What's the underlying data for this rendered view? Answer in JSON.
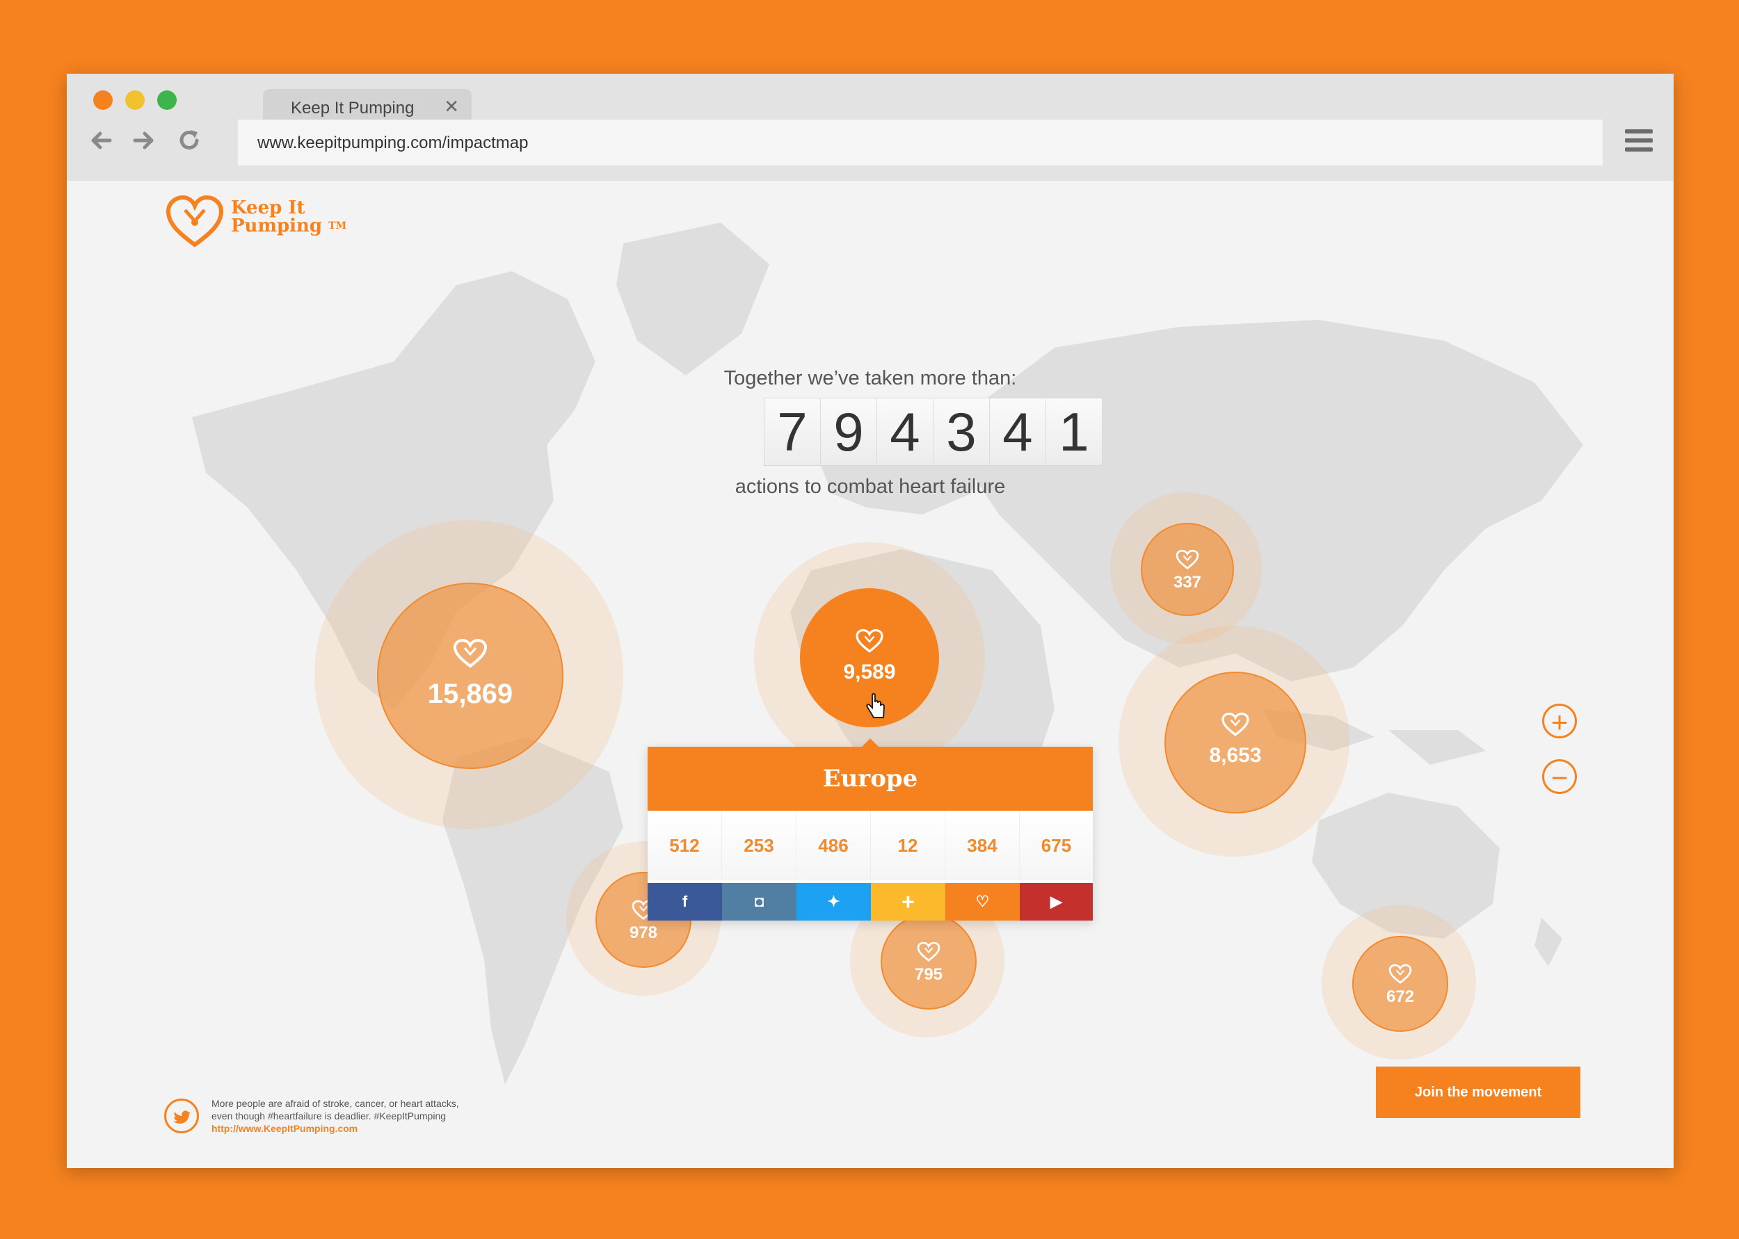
{
  "browser": {
    "tab_title": "Keep It Pumping",
    "tab_close": "✕",
    "url": "www.keepitpumping.com/impactmap"
  },
  "logo": {
    "line1": "Keep It",
    "line2": "Pumping",
    "tm": "TM"
  },
  "counter": {
    "intro": "Together we’ve taken more than:",
    "digits": [
      "7",
      "9",
      "4",
      "3",
      "4",
      "1"
    ],
    "outro": "actions to combat heart failure"
  },
  "bubbles": [
    {
      "value": "15,869"
    },
    {
      "value": "9,589"
    },
    {
      "value": "337"
    },
    {
      "value": "8,653"
    },
    {
      "value": "978"
    },
    {
      "value": "795"
    },
    {
      "value": "672"
    }
  ],
  "popup": {
    "region": "Europe",
    "counts": [
      "512",
      "253",
      "486",
      "12",
      "384",
      "675"
    ],
    "networks": [
      {
        "icon": "facebook-icon",
        "glyph": "f",
        "color": "#3b5998"
      },
      {
        "icon": "instagram-icon",
        "glyph": "◘",
        "color": "#517fa4"
      },
      {
        "icon": "twitter-icon",
        "glyph": "✦",
        "color": "#1da1f2"
      },
      {
        "icon": "plus-icon",
        "glyph": "+",
        "color": "#fdb92c"
      },
      {
        "icon": "heart-icon",
        "glyph": "♡",
        "color": "#f5821f"
      },
      {
        "icon": "youtube-icon",
        "glyph": "▶",
        "color": "#c4302b"
      }
    ]
  },
  "zoom": {
    "in": "+",
    "out": "−"
  },
  "footer": {
    "tweet_line1": "More people are afraid of stroke, cancer, or heart attacks,",
    "tweet_line2": "even though #heartfailure is deadlier. #KeepItPumping",
    "tweet_link": "http://www.KeepItPumping.com",
    "join_label": "Join the movement"
  },
  "colors": {
    "brand": "#f5821f",
    "background": "#f3f3f3",
    "map_land": "#dcdcdc"
  }
}
